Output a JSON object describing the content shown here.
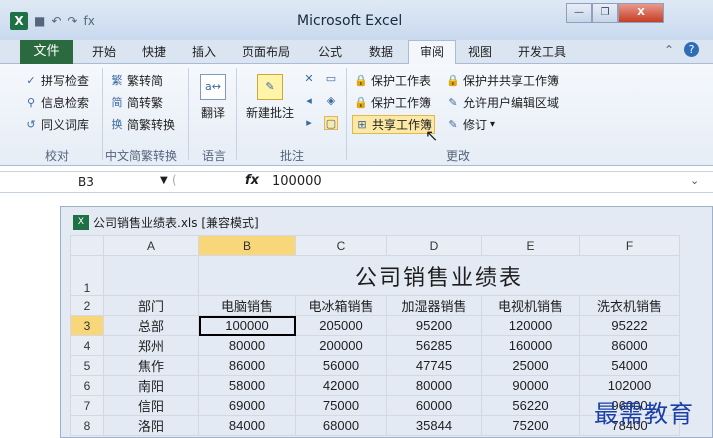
{
  "app": {
    "title": "Microsoft Excel"
  },
  "quick_access": {
    "logo": "X",
    "save_icon": "■",
    "undo_icon": "↶",
    "redo_icon": "↷",
    "fx_icon": "fx"
  },
  "window_controls": {
    "minimize": "—",
    "restore": "❐",
    "close": "X"
  },
  "tabs": [
    {
      "label": "文件"
    },
    {
      "label": "开始"
    },
    {
      "label": "快捷"
    },
    {
      "label": "插入"
    },
    {
      "label": "页面布局"
    },
    {
      "label": "公式"
    },
    {
      "label": "数据"
    },
    {
      "label": "审阅"
    },
    {
      "label": "视图"
    },
    {
      "label": "开发工具"
    }
  ],
  "ribbon": {
    "proofing": {
      "items": [
        "拼写检查",
        "信息检索",
        "同义词库"
      ],
      "label": "校对"
    },
    "chinese": {
      "items": [
        "繁转简",
        "简转繁",
        "简繁转换"
      ],
      "label": "中文简繁转换"
    },
    "language": {
      "button": "翻译",
      "label": "语言"
    },
    "comments": {
      "button": "新建批注",
      "label": "批注"
    },
    "changes": {
      "items": [
        "保护工作表",
        "保护并共享工作簿",
        "保护工作簿",
        "允许用户编辑区域",
        "共享工作簿",
        "修订"
      ],
      "label": "更改",
      "revise_dropdown": "▾"
    }
  },
  "formula_bar": {
    "name_box": "B3",
    "fx": "fx",
    "value": "100000"
  },
  "workbook": {
    "title": "公司销售业绩表.xls  [兼容模式]"
  },
  "sheet": {
    "columns": [
      "A",
      "B",
      "C",
      "D",
      "E",
      "F"
    ],
    "title": "公司销售业绩表",
    "headers": [
      "部门",
      "电脑销售",
      "电冰箱销售",
      "加湿器销售",
      "电视机销售",
      "洗衣机销售"
    ],
    "rows": [
      {
        "n": "3",
        "cells": [
          "总部",
          "100000",
          "205000",
          "95200",
          "120000",
          "95222"
        ]
      },
      {
        "n": "4",
        "cells": [
          "郑州",
          "80000",
          "200000",
          "56285",
          "160000",
          "86000"
        ]
      },
      {
        "n": "5",
        "cells": [
          "焦作",
          "86000",
          "56000",
          "47745",
          "25000",
          "54000"
        ]
      },
      {
        "n": "6",
        "cells": [
          "南阳",
          "58000",
          "42000",
          "80000",
          "90000",
          "102000"
        ]
      },
      {
        "n": "7",
        "cells": [
          "信阳",
          "69000",
          "75000",
          "60000",
          "56220",
          "96000"
        ]
      },
      {
        "n": "8",
        "cells": [
          "洛阳",
          "84000",
          "68000",
          "35844",
          "75200",
          "78400"
        ]
      }
    ]
  },
  "watermark": "最需教育"
}
